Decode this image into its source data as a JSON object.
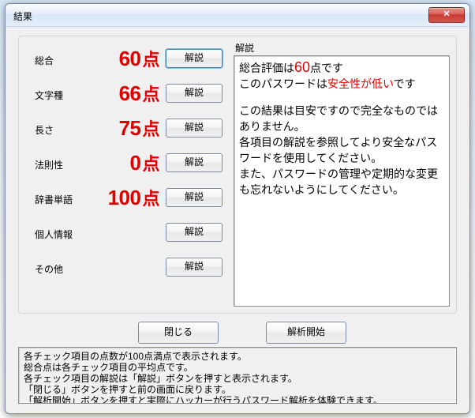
{
  "window": {
    "title": "結果",
    "close_label": "✕"
  },
  "scores": {
    "rows": [
      {
        "label": "総合",
        "value": "60",
        "unit": "点",
        "button": "解説",
        "highlight": true,
        "focus": true
      },
      {
        "label": "文字種",
        "value": "66",
        "unit": "点",
        "button": "解説",
        "highlight": true,
        "focus": false
      },
      {
        "label": "長さ",
        "value": "75",
        "unit": "点",
        "button": "解説",
        "highlight": true,
        "focus": false
      },
      {
        "label": "法則性",
        "value": "0",
        "unit": "点",
        "button": "解説",
        "highlight": true,
        "focus": false
      },
      {
        "label": "辞書単語",
        "value": "100",
        "unit": "点",
        "button": "解説",
        "highlight": true,
        "focus": false
      },
      {
        "label": "個人情報",
        "value": "",
        "unit": "",
        "button": "解説",
        "highlight": false,
        "focus": false
      },
      {
        "label": "その他",
        "value": "",
        "unit": "",
        "button": "解説",
        "highlight": false,
        "focus": false
      }
    ]
  },
  "explain": {
    "header": "解説",
    "line1a": "総合評価は",
    "line1b": "60",
    "line1c": "点です",
    "line2a": "このパスワードは",
    "line2b": "安全性が低い",
    "line2c": "です",
    "block2_l1": "この結果は目安ですので完全なものではありません。",
    "block2_l2": "各項目の解説を参照してより安全なパスワードを使用してください。",
    "block2_l3": "また、パスワードの管理や定期的な変更も忘れないようにしてください。"
  },
  "buttons": {
    "close": "閉じる",
    "start": "解析開始"
  },
  "footer": {
    "l1": "各チェック項目の点数が100点満点で表示されます。",
    "l2": "総合点は各チェック項目の平均点です。",
    "l3": "各チェック項目の解説は「解説」ボタンを押すと表示されます。",
    "l4": "「閉じる」ボタンを押すと前の画面に戻ります。",
    "l5": "「解析開始」ボタンを押すと実際にハッカーが行うパスワード解析を体験できます。"
  }
}
